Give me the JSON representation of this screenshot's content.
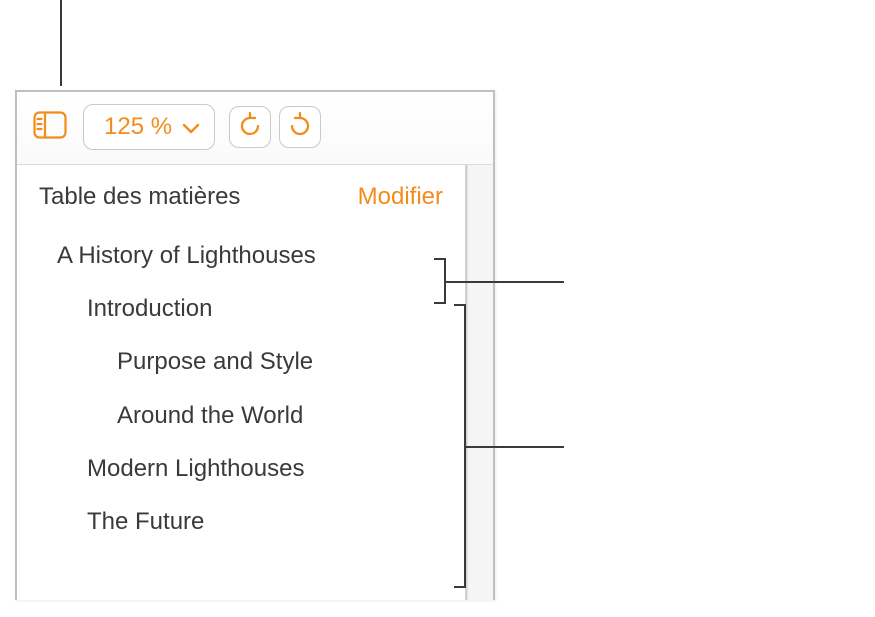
{
  "toolbar": {
    "zoom_value": "125 %"
  },
  "toc": {
    "title": "Table des matières",
    "edit_label": "Modifier",
    "items": [
      {
        "label": "A History of Lighthouses",
        "level": 0
      },
      {
        "label": "Introduction",
        "level": 1
      },
      {
        "label": "Purpose and Style",
        "level": 2
      },
      {
        "label": "Around the World",
        "level": 2
      },
      {
        "label": "Modern Lighthouses",
        "level": 1
      },
      {
        "label": "The Future",
        "level": 1
      }
    ]
  },
  "colors": {
    "accent": "#f28c1a"
  }
}
